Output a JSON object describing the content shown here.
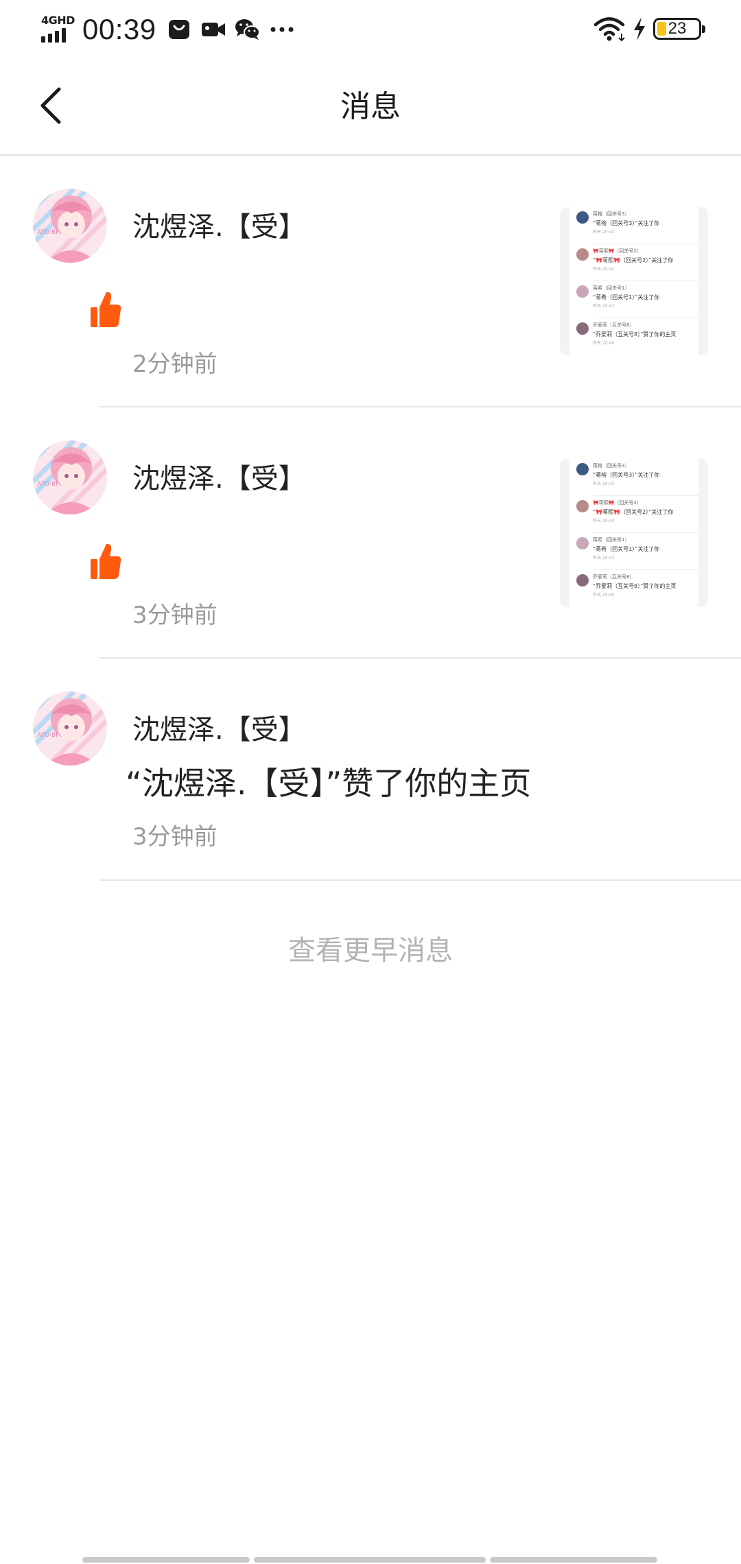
{
  "status_bar": {
    "network": "4GHD",
    "time": "00:39",
    "icons": [
      "shopping-bag-icon",
      "video-camera-icon",
      "wechat-icon",
      "more-dots-icon"
    ],
    "right_icons": [
      "wifi-icon",
      "charging-bolt-icon",
      "battery-icon"
    ],
    "battery_level": "23",
    "battery_fraction": 0.23
  },
  "header": {
    "title": "消息",
    "back_icon": "chevron-left-icon"
  },
  "messages": [
    {
      "sender": "沈煜泽.【受】",
      "type": "like",
      "icon": "thumbs-up-icon",
      "time": "2分钟前",
      "preview": [
        {
          "name": "蒋榕（回关号3）",
          "text": "“蒋榕（回关号3）”关注了你",
          "time": "昨天 20:43"
        },
        {
          "name": "🎀蒋熙🎀（回关号2）",
          "text": "“🎀蒋熙🎀（回关号2）”关注了你",
          "time": "昨天 20:44"
        },
        {
          "name": "蒋希（回关号1）",
          "text": "“蒋希（回关号1）”关注了你",
          "time": "昨天 20:43"
        },
        {
          "name": "乔爱莉（互关号8）",
          "text": "“乔爱莉（互关号8）”赞了你的主页",
          "time": "昨天 20:40"
        }
      ]
    },
    {
      "sender": "沈煜泽.【受】",
      "type": "like",
      "icon": "thumbs-up-icon",
      "time": "3分钟前",
      "preview": [
        {
          "name": "蒋榕（回关号3）",
          "text": "“蒋榕（回关号3）”关注了你",
          "time": "昨天 20:43"
        },
        {
          "name": "🎀蒋熙🎀（回关号2）",
          "text": "“🎀蒋熙🎀（回关号2）”关注了你",
          "time": "昨天 20:44"
        },
        {
          "name": "蒋希（回关号1）",
          "text": "“蒋希（回关号1）”关注了你",
          "time": "昨天 20:43"
        },
        {
          "name": "乔爱莉（互关号8）",
          "text": "“乔爱莉（互关号8）”赞了你的主页",
          "time": "昨天 20:40"
        }
      ]
    },
    {
      "sender": "沈煜泽.【受】",
      "type": "text",
      "content": "“沈煜泽.【受】”赞了你的主页",
      "time": "3分钟前"
    }
  ],
  "more_link": "查看更早消息",
  "colors": {
    "accent": "#ff5a10",
    "text": "#222222",
    "muted": "#9a9a9a",
    "link_muted": "#b3b3b3",
    "divider": "#e6e6e6",
    "battery": "#f6c21c"
  }
}
